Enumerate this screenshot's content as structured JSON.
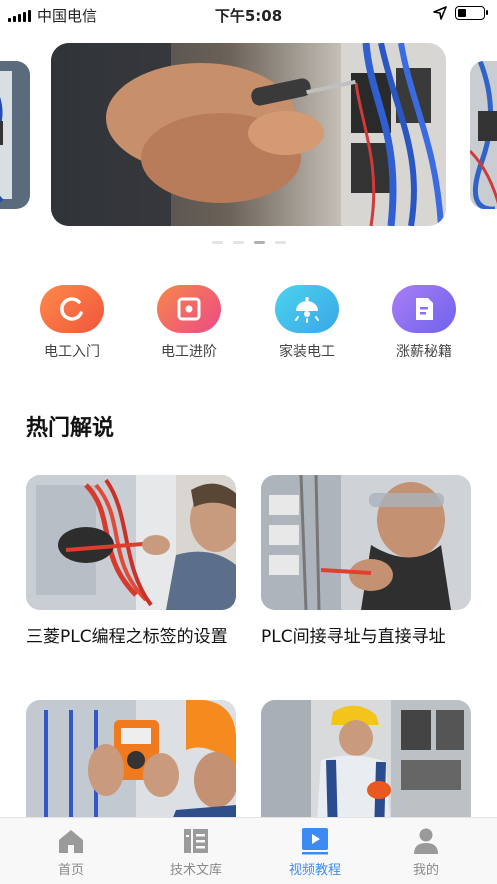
{
  "status_bar": {
    "carrier": "中国电信",
    "time": "下午5:08",
    "battery_level": 0.35
  },
  "banner": {
    "slide_count": 4,
    "active_index": 2
  },
  "categories": [
    {
      "label": "电工入门",
      "icon": "refresh-circle-icon",
      "color": "#f2673e"
    },
    {
      "label": "电工进阶",
      "icon": "square-target-icon",
      "color": "#f0577a"
    },
    {
      "label": "家装电工",
      "icon": "ceiling-lamp-icon",
      "color": "#3fb8e8"
    },
    {
      "label": "涨薪秘籍",
      "icon": "document-icon",
      "color": "#8f6af0"
    }
  ],
  "section": {
    "title": "热门解说"
  },
  "videos": [
    {
      "title": "三菱PLC编程之标签的设置"
    },
    {
      "title": "PLC间接寻址与直接寻址"
    },
    {
      "title": ""
    },
    {
      "title": ""
    }
  ],
  "tabbar": {
    "tabs": [
      {
        "label": "首页",
        "icon": "home-icon"
      },
      {
        "label": "技术文库",
        "icon": "library-icon"
      },
      {
        "label": "视频教程",
        "icon": "video-icon"
      },
      {
        "label": "我的",
        "icon": "user-icon"
      }
    ],
    "active_index": 2,
    "active_color": "#3d8bf2",
    "inactive_color": "#8a8a8a"
  }
}
